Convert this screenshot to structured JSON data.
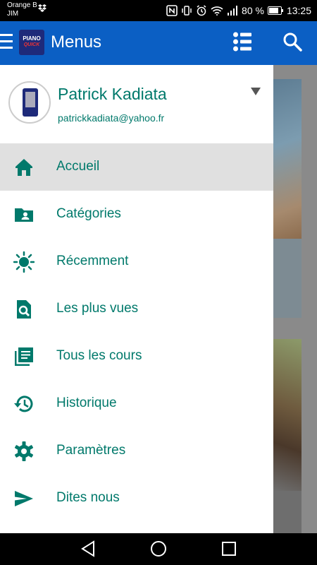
{
  "status_bar": {
    "carrier_line1": "Orange B",
    "carrier_line2": "JIM",
    "battery": "80 %",
    "time": "13:25"
  },
  "app_bar": {
    "logo_line1": "PIANO",
    "logo_line2": "QUICK",
    "title": "Menus"
  },
  "profile": {
    "name": "Patrick Kadiata",
    "email": "patrickkadiata@yahoo.fr"
  },
  "menu": {
    "items": [
      {
        "label": "Accueil",
        "icon": "home-icon",
        "active": true
      },
      {
        "label": "Catégories",
        "icon": "folder-account-icon",
        "active": false
      },
      {
        "label": "Récemment",
        "icon": "sun-icon",
        "active": false
      },
      {
        "label": "Les plus vues",
        "icon": "file-search-icon",
        "active": false
      },
      {
        "label": "Tous les cours",
        "icon": "library-books-icon",
        "active": false
      },
      {
        "label": "Historique",
        "icon": "history-icon",
        "active": false
      },
      {
        "label": "Paramètres",
        "icon": "gear-icon",
        "active": false
      },
      {
        "label": "Dites nous",
        "icon": "send-icon",
        "active": false
      }
    ]
  },
  "colors": {
    "app_bar": "#0b5fc4",
    "accent_teal": "#00796b",
    "active_item_bg": "#e0e0e0"
  }
}
